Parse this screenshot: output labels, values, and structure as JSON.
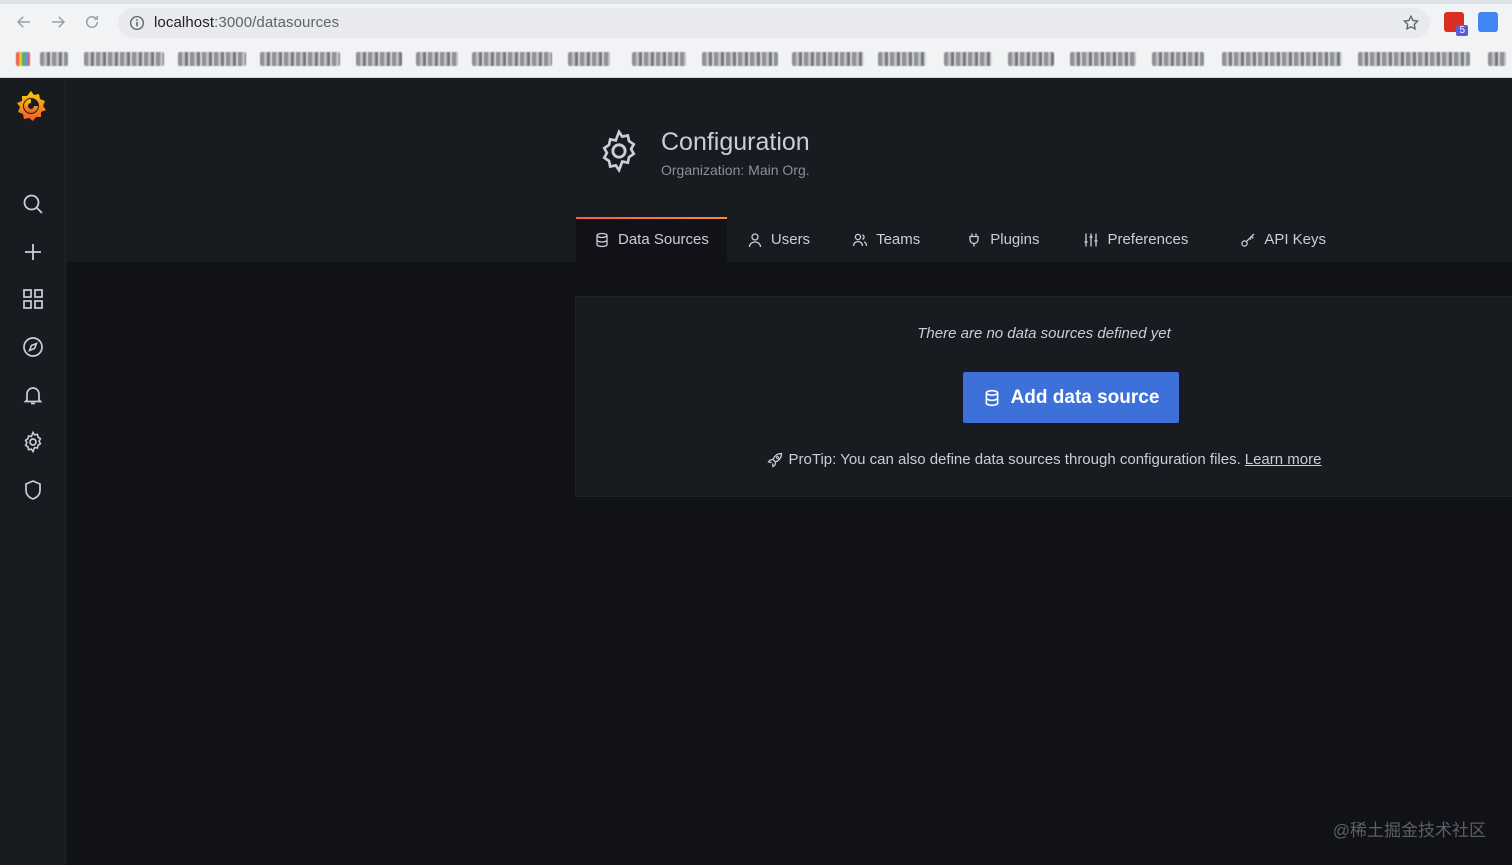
{
  "browser": {
    "url_host": "localhost",
    "url_path": ":3000/datasources"
  },
  "page": {
    "title": "Configuration",
    "subtitle": "Organization: Main Org."
  },
  "tabs": [
    {
      "label": "Data Sources",
      "icon": "database-icon",
      "active": true
    },
    {
      "label": "Users",
      "icon": "user-icon",
      "active": false
    },
    {
      "label": "Teams",
      "icon": "users-icon",
      "active": false
    },
    {
      "label": "Plugins",
      "icon": "plug-icon",
      "active": false
    },
    {
      "label": "Preferences",
      "icon": "sliders-icon",
      "active": false
    },
    {
      "label": "API Keys",
      "icon": "key-icon",
      "active": false
    }
  ],
  "empty_state": {
    "message": "There are no data sources defined yet",
    "button_label": "Add data source",
    "protip_text": "ProTip: You can also define data sources through configuration files.",
    "protip_link": "Learn more"
  },
  "sidebar_icons": [
    "grafana-logo-icon",
    "search-icon",
    "plus-icon",
    "dashboards-icon",
    "explore-compass-icon",
    "alerting-bell-icon",
    "configuration-gear-icon",
    "server-admin-shield-icon"
  ],
  "extension_badge": "5",
  "watermark": "@稀土掘金技术社区",
  "colors": {
    "accent_blue": "#3d71d9",
    "tab_gradient_start": "#f55f3e",
    "tab_gradient_end": "#ff8833",
    "background": "#111217",
    "panel": "#181b1f",
    "text": "#ccccdc"
  }
}
